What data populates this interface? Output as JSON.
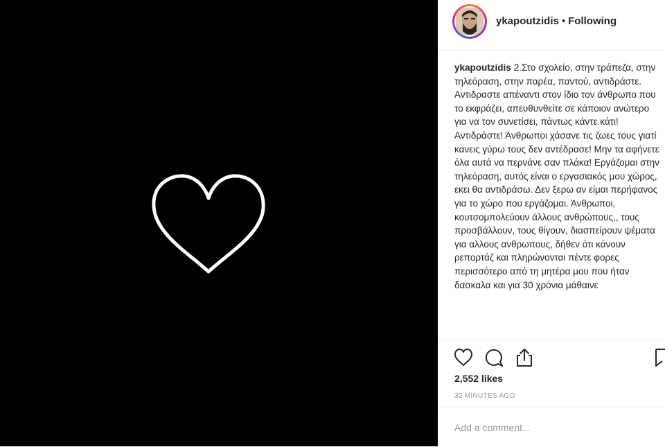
{
  "header": {
    "username": "ykapoutzidis",
    "separator": "•",
    "follow_status": "Following"
  },
  "caption": {
    "username": "ykapoutzidis",
    "text": "2.Στο σχολείο, στην τράπεζα, στην τηλεόραση, στην παρέα, παντού, αντιδράστε. Αντιδραστε απέναντι στον ίδιο τον άνθρωπο που το εκφράζει, απευθυνθείτε σε κάποιον ανώτερο για να τον συνετίσει, πάντως κάντε κάτι! Αντιδράστε! Άνθρωποι χάσανε τις ζωες τους γιατί κανεις γύρω τους δεν αντέδρασε! Μην τα αφήνετε όλα αυτά να περνάνε σαν πλάκα! Εργάζομαι στην τηλεόραση, αυτός είναι ο εργασιακός μου χώρος, εκει θα αντιδράσω. Δεν ξερω αν είμαι περήφανος για το χώρο που εργάζομαι. Άνθρωποι, κουτσομπολεύουν άλλους ανθρώπους,, τους προσβάλλουν, τους θίγουν, διασπείρουν ψέματα για αλλους ανθρωπους, δήθεν ότι κάνουν ρεπορτάζ και πληρώνονται πέντε φορες περισσότερο από τη μητέρα μου που ήταν δασκαλα και για 30 χρόνια μάθαινε"
  },
  "icons": {
    "like": "heart-outline-icon",
    "comment": "speech-bubble-icon",
    "share": "share-arrow-icon",
    "save": "bookmark-icon",
    "post_image": "white-heart-outline"
  },
  "stats": {
    "likes": "2,552 likes",
    "time": "32 MINUTES AGO"
  },
  "comment": {
    "placeholder": "Add a comment..."
  },
  "colors": {
    "media_background": "#000000",
    "text": "#262626",
    "muted": "#999999"
  }
}
